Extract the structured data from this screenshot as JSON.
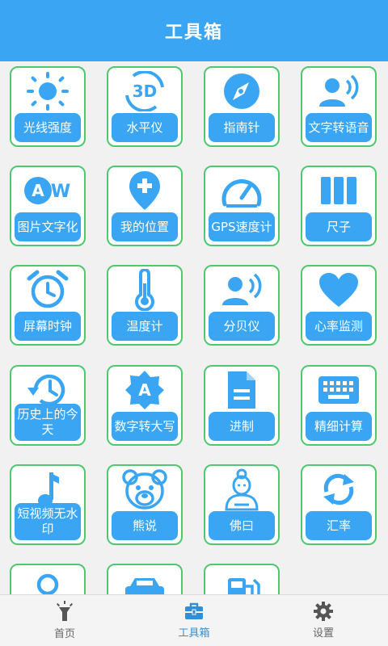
{
  "header": {
    "title": "工具箱"
  },
  "tools": [
    {
      "label": "光线强度",
      "icon": "sun-icon"
    },
    {
      "label": "水平仪",
      "icon": "level-3d-icon"
    },
    {
      "label": "指南针",
      "icon": "compass-icon"
    },
    {
      "label": "文字转语音",
      "icon": "speaker-person-icon"
    },
    {
      "label": "图片文字化",
      "icon": "ocr-aw-icon"
    },
    {
      "label": "我的位置",
      "icon": "location-pin-icon"
    },
    {
      "label": "GPS速度计",
      "icon": "speedometer-icon"
    },
    {
      "label": "尺子",
      "icon": "ruler-bars-icon"
    },
    {
      "label": "屏幕时钟",
      "icon": "alarm-clock-icon"
    },
    {
      "label": "温度计",
      "icon": "thermometer-icon"
    },
    {
      "label": "分贝仪",
      "icon": "sound-person-icon"
    },
    {
      "label": "心率监测",
      "icon": "heart-icon"
    },
    {
      "label": "历史上的今天",
      "icon": "history-clock-icon"
    },
    {
      "label": "数字转大写",
      "icon": "letter-a-badge-icon"
    },
    {
      "label": "进制",
      "icon": "document-icon"
    },
    {
      "label": "精细计算",
      "icon": "keyboard-icon"
    },
    {
      "label": "短视频无水印",
      "icon": "music-note-icon"
    },
    {
      "label": "熊说",
      "icon": "bear-icon"
    },
    {
      "label": "佛曰",
      "icon": "buddha-icon"
    },
    {
      "label": "汇率",
      "icon": "refresh-icon"
    },
    {
      "label": "",
      "icon": "person-icon"
    },
    {
      "label": "",
      "icon": "car-icon"
    },
    {
      "label": "",
      "icon": "gas-station-icon"
    }
  ],
  "nav": [
    {
      "label": "首页",
      "icon": "flashlight-icon",
      "active": false
    },
    {
      "label": "工具箱",
      "icon": "toolbox-icon",
      "active": true
    },
    {
      "label": "设置",
      "icon": "gear-icon",
      "active": false
    }
  ],
  "colors": {
    "primary": "#3aa6f3",
    "tile_border": "#4fc96f",
    "icon": "#3aa6f3"
  }
}
